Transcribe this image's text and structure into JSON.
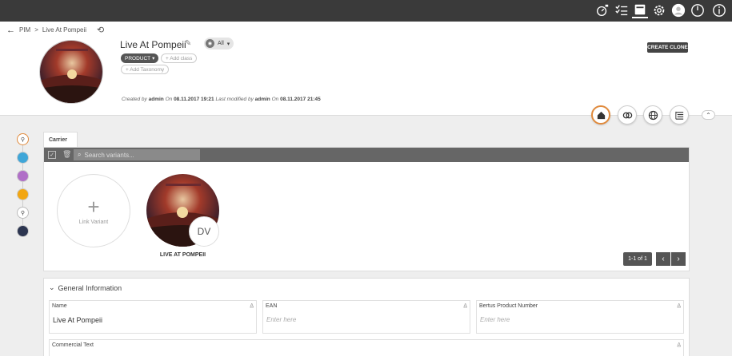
{
  "topbar": {
    "icons": [
      "dashboard-icon",
      "tasklist-icon",
      "inbox-icon",
      "settings-icon",
      "user-icon",
      "power-icon",
      "info-icon"
    ]
  },
  "breadcrumb": {
    "root": "PIM",
    "separator": ">",
    "current": "Live At Pompeii"
  },
  "header": {
    "title": "Live At Pompeii",
    "all_label": "All",
    "product_tag": "PRODUCT",
    "add_class": "+ Add class",
    "add_taxonomy": "+ Add Taxonomy",
    "meta": {
      "created_by_label": "Created by",
      "created_by": "admin",
      "on_label": "On",
      "created_on": "08.11.2017 19:21",
      "modified_label": "Last modified by",
      "modified_by": "admin",
      "modified_on": "08.11.2017 21:45"
    },
    "clone_button": "CREATE CLONE"
  },
  "variants": {
    "tab_label": "Carrier",
    "search_placeholder": "Search variants...",
    "link_label": "Link Variant",
    "items": [
      {
        "name": "LIVE AT POMPEII",
        "badge": "DV"
      }
    ],
    "pager": "1-1 of 1"
  },
  "general": {
    "heading": "General Information",
    "fields": [
      {
        "label": "Name",
        "value": "Live At Pompeii",
        "placeholder": ""
      },
      {
        "label": "EAN",
        "value": "",
        "placeholder": "Enter here"
      },
      {
        "label": "Bertus Product Number",
        "value": "",
        "placeholder": "Enter here"
      },
      {
        "label": "Commercial Text",
        "value": "",
        "placeholder": ""
      }
    ]
  },
  "colors": {
    "topbar": "#3a3a3a",
    "accent": "#e08a3c",
    "toolbar": "#666666"
  }
}
